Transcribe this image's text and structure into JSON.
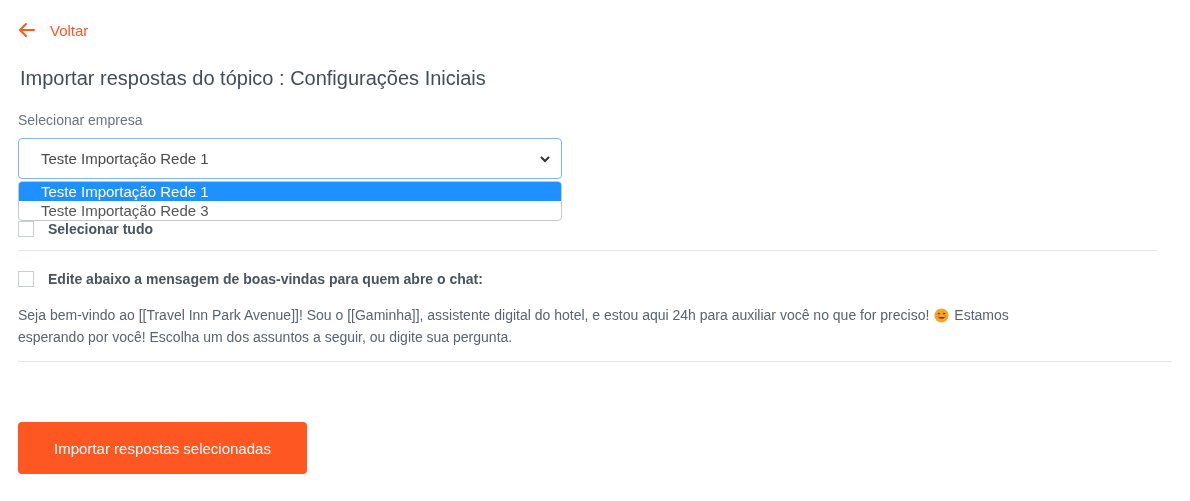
{
  "back_link": {
    "label": "Voltar"
  },
  "title": "Importar respostas do tópico : Configurações Iniciais",
  "company_select": {
    "label": "Selecionar empresa",
    "value": "Teste Importação Rede 1",
    "expanded": true,
    "options": [
      {
        "label": "Teste Importação Rede 1",
        "selected": true
      },
      {
        "label": "Teste Importação Rede 3",
        "selected": false
      }
    ]
  },
  "select_all": {
    "label": "Selecionar tudo",
    "checked": false
  },
  "answers": [
    {
      "label": "Edite abaixo a mensagem de boas-vindas para quem abre o chat:",
      "checked": false,
      "message_before": "Seja bem-vindo ao [[Travel Inn Park Avenue]]! Sou o [[Gaminha]], assistente digital do hotel, e estou aqui 24h para auxiliar você no que for preciso!",
      "message_after": "Estamos",
      "message_continued": "esperando por você! Escolha um dos assuntos a seguir, ou digite sua pergunta."
    }
  ],
  "submit_button": "Importar respostas selecionadas"
}
